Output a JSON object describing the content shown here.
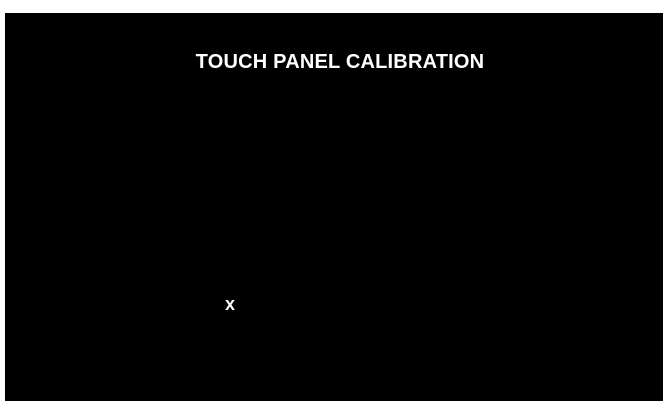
{
  "screen": {
    "title": "TOUCH PANEL CALIBRATION",
    "target_marker": "x"
  },
  "colors": {
    "background": "#000000",
    "text": "#ffffff"
  }
}
